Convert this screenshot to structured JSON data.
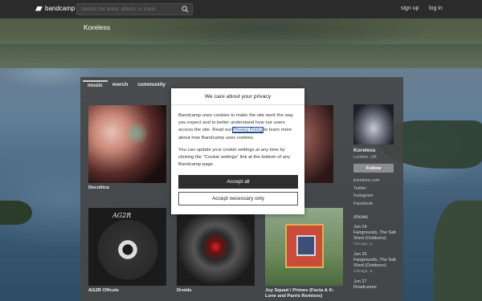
{
  "topbar": {
    "logo_text": "bandcamp",
    "search_placeholder": "Search for artist, album, or track",
    "signup": "sign up",
    "login": "log in"
  },
  "artist_header": "Koreless",
  "tabs": [
    {
      "label": "music",
      "active": true
    },
    {
      "label": "merch",
      "active": false
    },
    {
      "label": "community",
      "active": false
    }
  ],
  "albums": [
    {
      "title": "Decoltica"
    },
    {
      "title": "AG2R Offcuts"
    },
    {
      "title": "Droids"
    },
    {
      "title": "Joy Squad / Primes (Facta & K-Lone and Parris Remixes)"
    }
  ],
  "ag2r_art_text": "AG2R",
  "sidebar": {
    "name": "Koreless",
    "location": "London, UK",
    "follow": "Follow",
    "links": [
      "koreless.com",
      "Twitter",
      "Instagram",
      "Facebook"
    ],
    "shows_heading": "shows",
    "shows": [
      {
        "date": "Jun 24",
        "venue": "Fairgrounds, The Salt Shed (Outdoors)",
        "city": "Chicago, IL"
      },
      {
        "date": "Jun 25",
        "venue": "Fairgrounds, The Salt Shed (Outdoors)",
        "city": "Chicago, IL"
      },
      {
        "date": "Jun 27",
        "venue": "Roadrunner",
        "city": ""
      }
    ]
  },
  "cookie_modal": {
    "title": "We care about your privacy",
    "para1_before": "Bandcamp uses cookies to make the site work the way you expect and to better understand how our users access the site. Read our ",
    "privacy_link": "Privacy Policy",
    "para1_after": " to learn more about how Bandcamp uses cookies.",
    "para2": "You can update your cookie settings at any time by clicking the “Cookie settings” link at the bottom of any Bandcamp page.",
    "accept_all": "Accept all",
    "accept_necessary": "Accept necessary only"
  },
  "colors": {
    "topbar": "#2b2b2b",
    "panel": "#464646",
    "accept_button": "#2e2e2e",
    "link": "#1a4e92"
  }
}
